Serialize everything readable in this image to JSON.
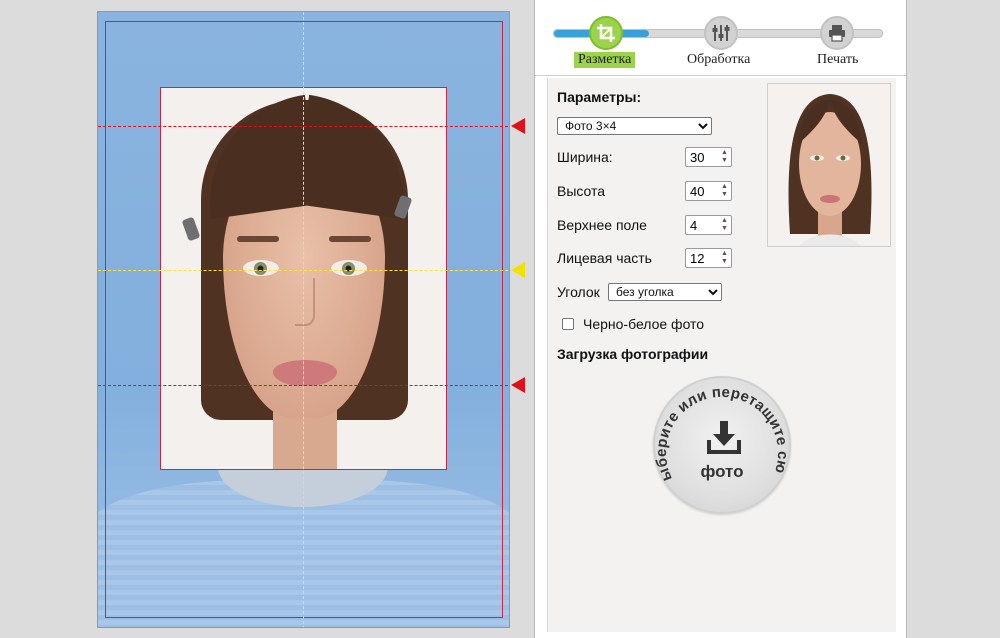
{
  "steps": {
    "items": [
      {
        "label": "Разметка",
        "icon": "crop-icon",
        "active": true
      },
      {
        "label": "Обработка",
        "icon": "sliders-icon",
        "active": false
      },
      {
        "label": "Печать",
        "icon": "printer-icon",
        "active": false
      }
    ],
    "progress_fraction": 0.29
  },
  "params": {
    "title": "Параметры:",
    "format_select": {
      "value": "Фото 3×4"
    },
    "width": {
      "label": "Ширина:",
      "value": "30"
    },
    "height": {
      "label": "Высота",
      "value": "40"
    },
    "top_margin": {
      "label": "Верхнее поле",
      "value": "4"
    },
    "face_part": {
      "label": "Лицевая часть",
      "value": "12"
    },
    "corner": {
      "label": "Уголок",
      "value": "без уголка"
    },
    "bw": {
      "label": "Черно-белое фото",
      "checked": false
    }
  },
  "upload": {
    "title": "Загрузка фотографии",
    "circle_text": "Выберите или перетащите сюда",
    "photo_label": "фото"
  },
  "colors": {
    "accent_green": "#9bd34a",
    "progress_blue": "#3aa0d8",
    "guide_red": "#e0101a",
    "guide_yellow": "#ffe23c",
    "frame_red": "#c0294a"
  }
}
